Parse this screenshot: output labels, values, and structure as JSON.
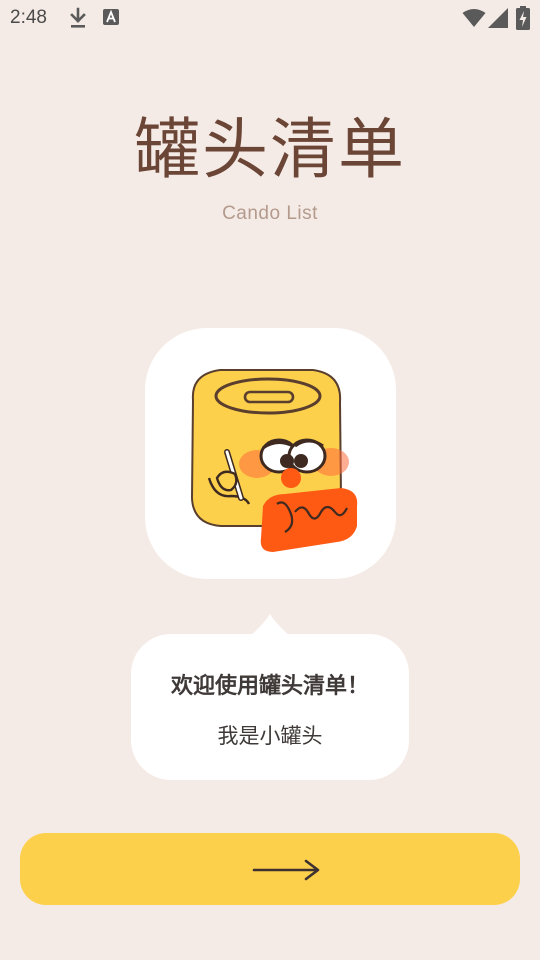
{
  "status_bar": {
    "time": "2:48",
    "icons": [
      "download-icon",
      "a-notification-icon",
      "wifi-icon",
      "signal-icon",
      "battery-charging-icon"
    ]
  },
  "app": {
    "title": "罐头清单",
    "subtitle": "Cando List"
  },
  "mascot": {
    "icon": "jar-mascot-icon"
  },
  "bubble": {
    "title": "欢迎使用罐头清单！",
    "text": "我是小罐头"
  },
  "next_button": {
    "icon": "arrow-right-icon"
  },
  "colors": {
    "background": "#f5ebe6",
    "title": "#6b4636",
    "subtitle": "#b39a8c",
    "button": "#fdd04c",
    "jar": "#fdd04c",
    "accent": "#ff5a14"
  }
}
